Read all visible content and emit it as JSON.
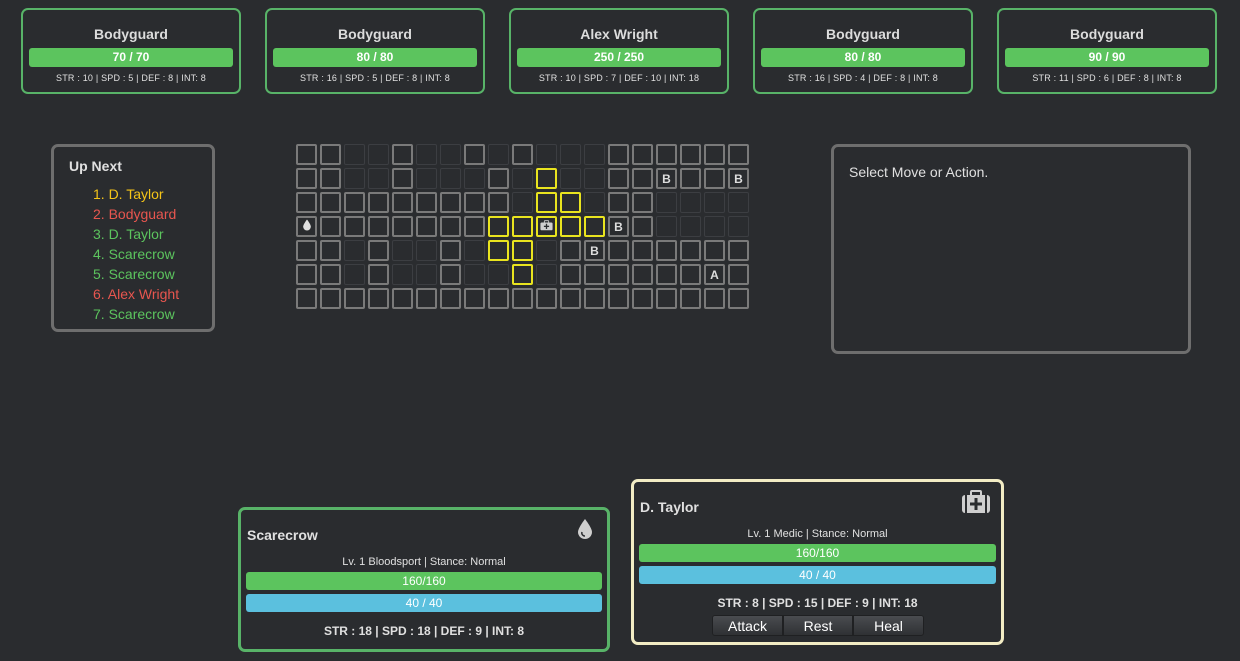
{
  "enemies": [
    {
      "name": "Bodyguard",
      "hp": "70 / 70",
      "stats": "STR : 10  |  SPD : 5  |  DEF : 8  |  INT: 8"
    },
    {
      "name": "Bodyguard",
      "hp": "80 / 80",
      "stats": "STR : 16  |  SPD : 5  |  DEF : 8  |  INT: 8"
    },
    {
      "name": "Alex Wright",
      "hp": "250 / 250",
      "stats": "STR : 10  |  SPD : 7  |  DEF : 10  |  INT: 18"
    },
    {
      "name": "Bodyguard",
      "hp": "80 / 80",
      "stats": "STR : 16  |  SPD : 4  |  DEF : 8  |  INT: 8"
    },
    {
      "name": "Bodyguard",
      "hp": "90 / 90",
      "stats": "STR : 11  |  SPD : 6  |  DEF : 8  |  INT: 8"
    }
  ],
  "up_next": {
    "title": "Up Next",
    "items": [
      {
        "label": "1. D. Taylor",
        "color": "#f5c518"
      },
      {
        "label": "2. Bodyguard",
        "color": "#e8564f"
      },
      {
        "label": "3. D. Taylor",
        "color": "#5cc45e"
      },
      {
        "label": "4. Scarecrow",
        "color": "#5cc45e"
      },
      {
        "label": "5. Scarecrow",
        "color": "#5cc45e"
      },
      {
        "label": "6. Alex Wright",
        "color": "#e8564f"
      },
      {
        "label": "7. Scarecrow",
        "color": "#5cc45e"
      }
    ]
  },
  "grid": {
    "rows": [
      "EEddEddEdd-EdEEEEEE",
      "EEdddEddd-Y-EEBEB",
      "EEEEEEEEddYYEE",
      "SEEEEEEYYMYYQE",
      "EEdEddEYYEdBEEEEE",
      "EEdEddEdYEEEEEAE",
      "EEEEEEEEEEEEEEEEEEE"
    ],
    "tiles": [
      "EEddEddEddEdddEEEEEE",
      "EEddEdddEdYdddEEBEB",
      "EEddEEEEEEdYYddEdddd",
      "SEEEEEEYYMYYdQEdddd",
      "EEddEddEYYddBEEEEE",
      "EEddEddEdYdEEEEAE",
      "EEEEEEEEEEEEEEEEEEE"
    ],
    "labels": {
      "B": "B",
      "A": "A"
    },
    "icons": {
      "S": "blood-drop-icon",
      "M": "medic-kit-icon"
    }
  },
  "message": "Select Move or Action.",
  "allies": [
    {
      "name": "Scarecrow",
      "info": "Lv. 1 Bloodsport   |   Stance: Normal",
      "hp": "160/160",
      "mp": "40 / 40",
      "stats": "STR : 18   |   SPD : 18   |   DEF : 9   |   INT: 8",
      "icon": "blood-drop-icon",
      "border": "#58b368"
    },
    {
      "name": "D. Taylor",
      "info": "Lv. 1 Medic   |   Stance: Normal",
      "hp": "160/160",
      "mp": "40 / 40",
      "stats": "STR : 8   |   SPD : 15   |   DEF : 9   |   INT: 18",
      "icon": "medic-kit-icon",
      "border": "#f2ecc4"
    }
  ],
  "actions": [
    "Attack",
    "Rest",
    "Heal"
  ]
}
